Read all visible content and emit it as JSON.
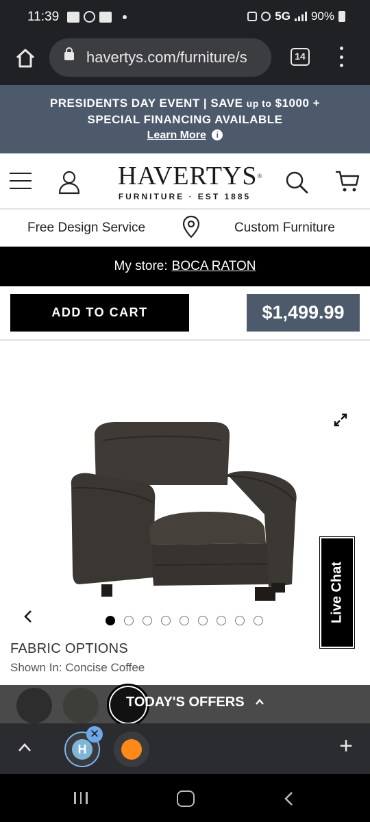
{
  "status_bar": {
    "time": "11:39",
    "network": "5G",
    "battery": "90%"
  },
  "browser": {
    "url": "havertys.com/furniture/s",
    "tab_count": "14"
  },
  "promo": {
    "line1_a": "PRESIDENTS DAY EVENT | SAVE",
    "line1_b": "up to",
    "line1_c": "$1000 +",
    "line2": "SPECIAL FINANCING AVAILABLE",
    "learn_more": "Learn More",
    "info_glyph": "i"
  },
  "header": {
    "logo_main": "HAVERTYS",
    "logo_mark": "®",
    "logo_sub": "FURNITURE · EST 1885"
  },
  "services": {
    "left": "Free Design Service",
    "right": "Custom Furniture"
  },
  "store": {
    "label": "My store:",
    "name": "BOCA RATON"
  },
  "cart": {
    "button": "ADD TO CART",
    "price": "$1,499.99"
  },
  "gallery": {
    "slide_count": 9,
    "active_slide": 1,
    "live_chat": "Live Chat"
  },
  "fabric": {
    "title": "FABRIC OPTIONS",
    "shown_in": "Shown In: Concise Coffee"
  },
  "offers": {
    "label": "TODAY'S OFFERS"
  },
  "toolbar": {
    "h_badge": "H",
    "close_glyph": "✕",
    "plus": "+"
  },
  "colors": {
    "brand_slate": "#4c5a6b",
    "black": "#000000",
    "chair_leather": "#3f3a35"
  }
}
